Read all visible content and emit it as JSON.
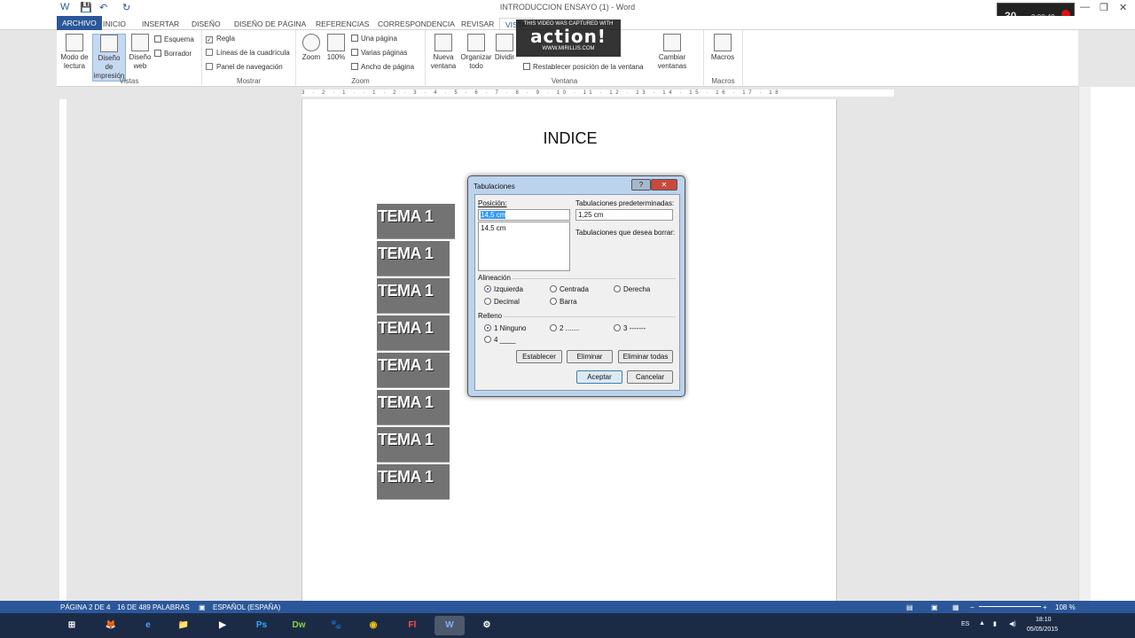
{
  "window": {
    "title": "INTRODUCCION ENSAYO (1) - Word",
    "quick_access": {
      "save": "💾",
      "undo": "↶",
      "redo": "↻"
    },
    "controls": {
      "minimize": "—",
      "maximize": "❐",
      "close": "✕"
    }
  },
  "tabs": [
    "ARCHIVO",
    "INICIO",
    "INSERTAR",
    "DISEÑO",
    "DISEÑO DE PÁGINA",
    "REFERENCIAS",
    "CORRESPONDENCIA",
    "REVISAR",
    "VISTA"
  ],
  "ribbon": {
    "vistas": {
      "label": "Vistas",
      "modo_lectura": "Modo de lectura",
      "diseno_impresion": "Diseño de impresión",
      "diseno_web": "Diseño web",
      "esquema": "Esquema",
      "borrador": "Borrador"
    },
    "mostrar": {
      "label": "Mostrar",
      "regla": "Regla",
      "lineas": "Líneas de la cuadrícula",
      "panel": "Panel de navegación"
    },
    "zoom": {
      "label": "Zoom",
      "zoom": "Zoom",
      "cien": "100%",
      "una_pagina": "Una página",
      "varias_paginas": "Varias páginas",
      "ancho_pagina": "Ancho de página"
    },
    "ventana": {
      "label": "Ventana",
      "nueva_ventana": "Nueva ventana",
      "organizar_todo": "Organizar todo",
      "dividir": "Dividir",
      "restablecer": "Restablecer posición de la ventana",
      "cambiar_ventanas": "Cambiar ventanas"
    },
    "macros": {
      "label": "Macros",
      "macros": "Macros"
    }
  },
  "watermark": {
    "line1": "THIS VIDEO WAS CAPTURED WITH",
    "line2": "action!",
    "line3": "WWW.MIRILLIS.COM"
  },
  "recorder": {
    "fps": "30",
    "time": "0:00:49"
  },
  "ruler": {
    "marks": "3 · 2 · 1 · · 1 · 2 · 3 · 4 · 5 · 6 · 7 · 8 · 9 · 10 · 11 · 12 · 13 · 14 · 15 · 16 · 17 · 18"
  },
  "document": {
    "title": "INDICE",
    "entries": [
      "TEMA 1",
      "TEMA 1",
      "TEMA 1",
      "TEMA 1",
      "TEMA 1",
      "TEMA 1",
      "TEMA 1",
      "TEMA 1"
    ]
  },
  "dialog": {
    "title": "Tabulaciones",
    "help": "?",
    "close": "✕",
    "posicion_label": "Posición:",
    "posicion_value": "14,5 cm",
    "posicion_list": [
      "14,5 cm"
    ],
    "predeterminadas_label": "Tabulaciones predeterminadas:",
    "predeterminadas_value": "1,25 cm",
    "borrar_label": "Tabulaciones que desea borrar:",
    "alineacion_label": "Alineación",
    "alineacion": {
      "izquierda": "Izquierda",
      "centrada": "Centrada",
      "derecha": "Derecha",
      "decimal": "Decimal",
      "barra": "Barra"
    },
    "relleno_label": "Relleno",
    "relleno": {
      "ninguno": "1 Ninguno",
      "dos": "2 .......",
      "tres": "3 -------",
      "cuatro": "4 ____"
    },
    "buttons": {
      "establecer": "Establecer",
      "eliminar": "Eliminar",
      "eliminar_todas": "Eliminar todas",
      "aceptar": "Aceptar",
      "cancelar": "Cancelar"
    }
  },
  "status": {
    "pagina": "PÁGINA 2 DE 4",
    "palabras": "16 DE 489 PALABRAS",
    "idioma": "ESPAÑOL (ESPAÑA)",
    "zoom": "108 %"
  },
  "taskbar": {
    "apps": [
      "⊞",
      "🦊",
      "e",
      "📁",
      "▶",
      "Ps",
      "Dw",
      "🐾",
      "◉",
      "Fl",
      "W",
      "⚙"
    ],
    "lang": "ES",
    "time": "18:10",
    "date": "05/05/2015"
  },
  "colors": {
    "word_blue": "#2b579a",
    "taskbar": "#1c2b45"
  }
}
